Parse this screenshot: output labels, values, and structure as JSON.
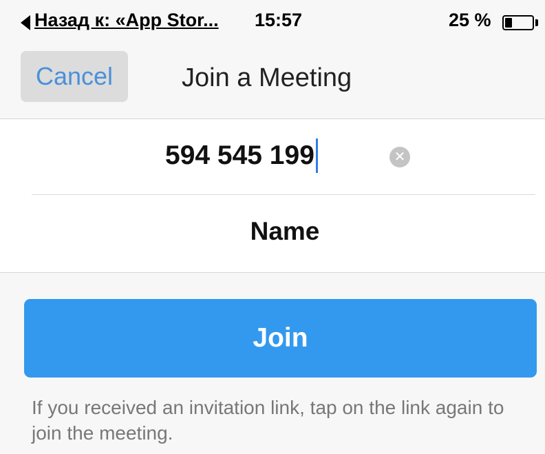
{
  "status_bar": {
    "back_label": "Назад к: «App Stor...",
    "time": "15:57",
    "battery_percent": "25 %",
    "battery_level": 0.25,
    "back_icon": "back-triangle-icon",
    "battery_icon": "battery-icon"
  },
  "nav": {
    "cancel_label": "Cancel",
    "title": "Join a Meeting"
  },
  "form": {
    "meeting_id_value": "594 545 199",
    "name_placeholder": "Name",
    "clear_icon": "clear-circle-icon",
    "clear_glyph": "✕"
  },
  "join": {
    "label": "Join"
  },
  "hint": {
    "text": "If you received an invitation link, tap on the link again to join the meeting."
  },
  "colors": {
    "accent": "#3399ee",
    "cancel_text": "#4a90d9",
    "background": "#f7f7f7"
  }
}
